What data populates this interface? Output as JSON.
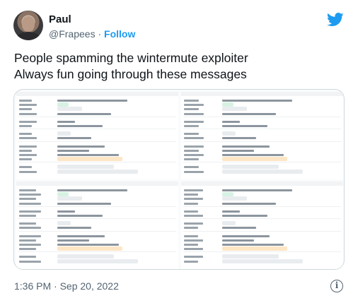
{
  "author": {
    "name": "Paul",
    "handle": "@Frapees",
    "separator": "·",
    "follow_label": "Follow"
  },
  "brand": {
    "icon": "twitter-bird-icon",
    "color": "#1d9bf0"
  },
  "tweet": {
    "lines": [
      "People spamming the wintermute exploiter",
      "Always fun going through these messages"
    ]
  },
  "media": {
    "description_icon": "etherscan-transactions-screenshot"
  },
  "footer": {
    "timestamp": "1:36 PM · Sep 20, 2022",
    "info_glyph": "i"
  },
  "colors": {
    "text": "#0f1419",
    "muted": "#536471",
    "accent": "#1d9bf0",
    "chip_green": "#d7f2e3",
    "chip_orange": "#fde6c5",
    "chip_gray": "#e9ecef"
  }
}
